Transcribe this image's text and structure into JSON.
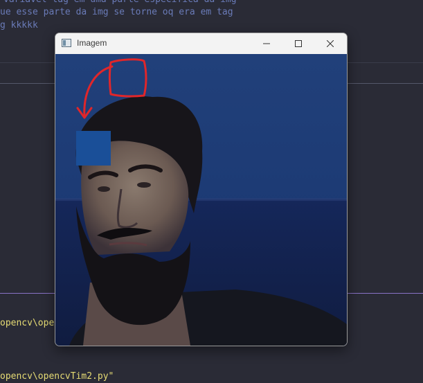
{
  "editor": {
    "lines": [
      "variavel tag em uma parte especifica da img",
      "ue esse parte da img se torne oq era em tag",
      "g kkkkk"
    ],
    "terminal_lines": [
      "opencv\\openc",
      "opencv\\opencvTim2.py\""
    ]
  },
  "window": {
    "title": "Imagem",
    "icon": "image-window-icon",
    "controls": [
      "minimize-icon",
      "maximize-icon",
      "close-icon"
    ]
  },
  "image": {
    "description_colors": {
      "sky": "#1f3f7a",
      "sea": "#14244f",
      "patch": "#1a4f98",
      "annotation": "#e0262a"
    }
  }
}
